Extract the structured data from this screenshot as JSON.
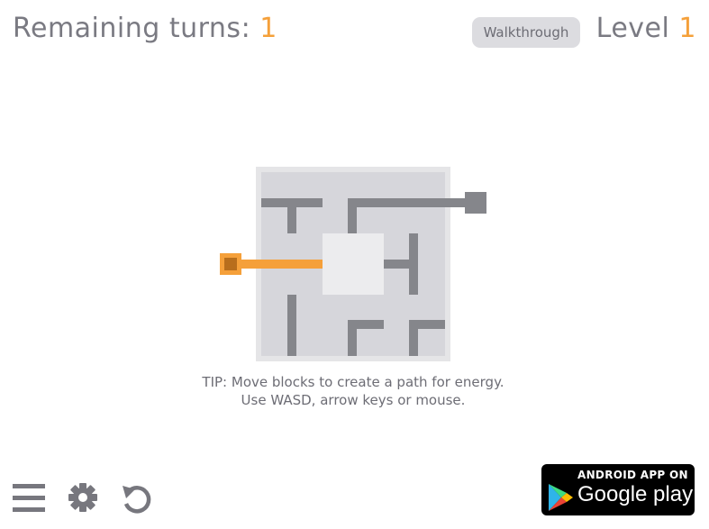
{
  "header": {
    "remaining_label": "Remaining turns:",
    "remaining_value": "1",
    "walkthrough_label": "Walkthrough",
    "level_label": "Level",
    "level_value": "1"
  },
  "tip": {
    "line1": "TIP: Move blocks to create a path for energy.",
    "line2": "Use WASD, arrow keys or mouse."
  },
  "footer": {
    "menu_icon": "hamburger-menu-icon",
    "settings_icon": "gear-icon",
    "restart_icon": "restart-icon",
    "store_badge_small": "ANDROID APP ON",
    "store_badge_big": "Google play"
  },
  "colors": {
    "accent": "#f5a03a",
    "wire": "#85868b",
    "board_bg": "#e5e5e7",
    "tile": "#d6d6db",
    "empty_slot": "#ececee"
  }
}
